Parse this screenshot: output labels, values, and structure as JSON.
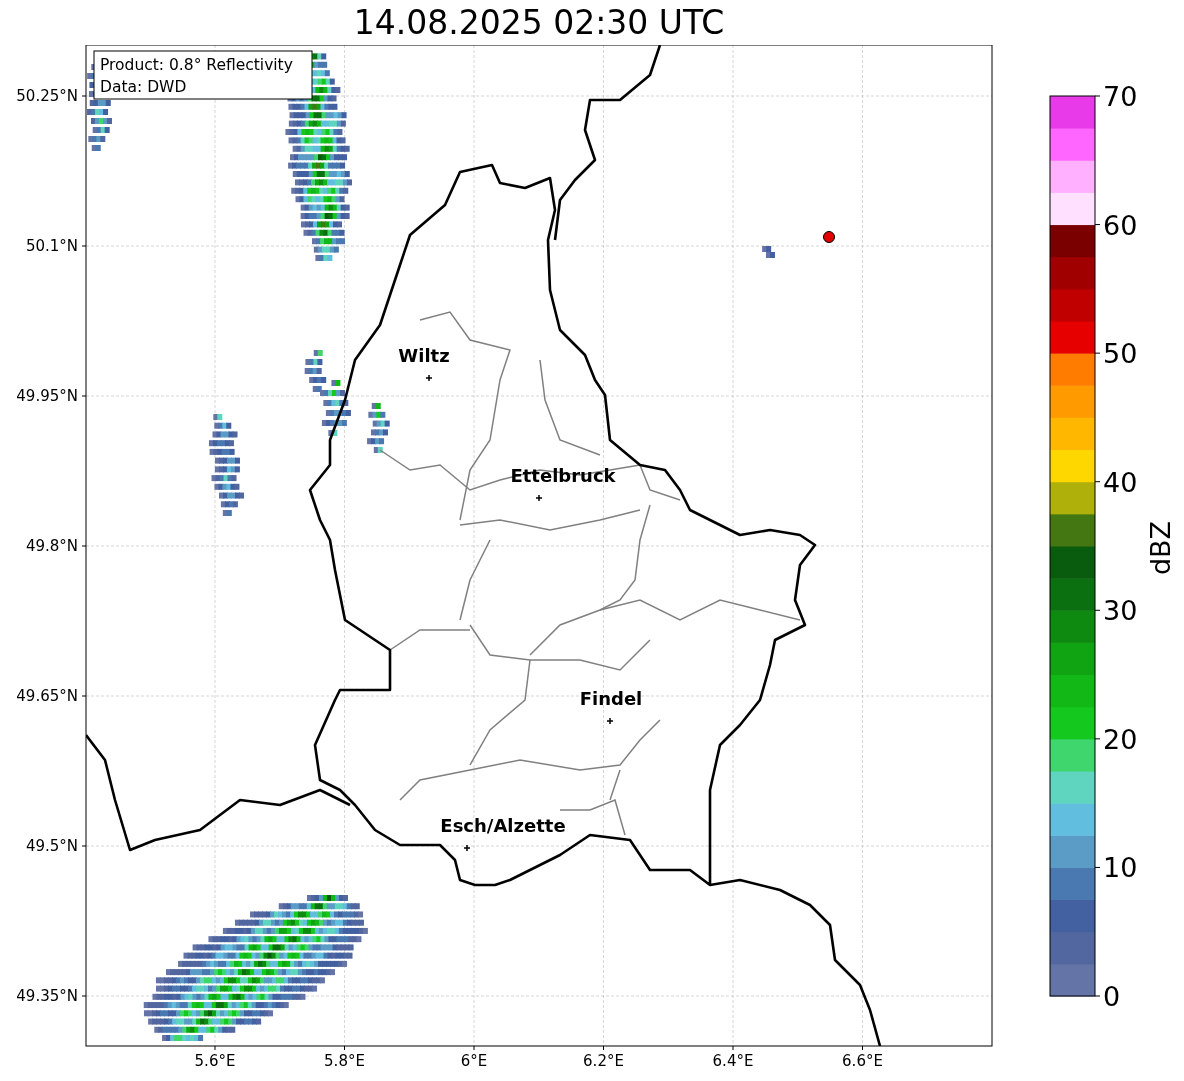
{
  "title": "14.08.2025 02:30 UTC",
  "legend": {
    "lines": [
      "Product: 0.8° Reflectivity",
      "Data: DWD"
    ]
  },
  "y_ticks": [
    "50.25°N",
    "50.1°N",
    "49.95°N",
    "49.8°N",
    "49.65°N",
    "49.5°N",
    "49.35°N"
  ],
  "x_ticks": [
    "5.6°E",
    "5.8°E",
    "6°E",
    "6.2°E",
    "6.4°E",
    "6.6°E"
  ],
  "cities": [
    {
      "name": "Wiltz"
    },
    {
      "name": "Ettelbruck"
    },
    {
      "name": "Findel"
    },
    {
      "name": "Esch/Alzette"
    }
  ],
  "colorbar": {
    "label": "dBZ",
    "ticks": [
      "70",
      "60",
      "50",
      "40",
      "30",
      "20",
      "10",
      "0"
    ],
    "bands": [
      {
        "color": "#6474a6"
      },
      {
        "color": "#52669f"
      },
      {
        "color": "#4360a0"
      },
      {
        "color": "#4a78b0"
      },
      {
        "color": "#5a9cc5"
      },
      {
        "color": "#62bede"
      },
      {
        "color": "#5fd5c0"
      },
      {
        "color": "#3fd66e"
      },
      {
        "color": "#14c81e"
      },
      {
        "color": "#12b815"
      },
      {
        "color": "#10a412"
      },
      {
        "color": "#0e8a10"
      },
      {
        "color": "#0b7010"
      },
      {
        "color": "#095c0d"
      },
      {
        "color": "#447612"
      },
      {
        "color": "#afb00a"
      },
      {
        "color": "#ffd700"
      },
      {
        "color": "#ffb700"
      },
      {
        "color": "#ff9b00"
      },
      {
        "color": "#ff7c00"
      },
      {
        "color": "#e60000"
      },
      {
        "color": "#c00000"
      },
      {
        "color": "#a00000"
      },
      {
        "color": "#7a0000"
      },
      {
        "color": "#ffe0ff"
      },
      {
        "color": "#ffb0ff"
      },
      {
        "color": "#ff66ff"
      },
      {
        "color": "#e93ae9"
      }
    ]
  }
}
